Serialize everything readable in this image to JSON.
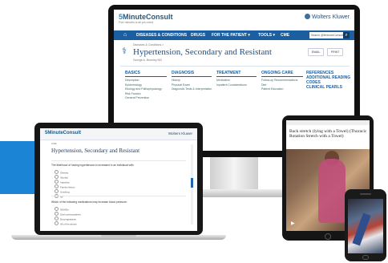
{
  "monitor": {
    "logo_prefix": "5",
    "logo_rest": "MinuteConsult",
    "tagline": "Five minutes is all you need",
    "brand": "Wolters Kluwer",
    "nav": [
      "DISEASES & CONDITIONS",
      "DRUGS",
      "FOR THE PATIENT ▾",
      "TOOLS ▾",
      "CME"
    ],
    "search_placeholder": "Search @5minuteConsult",
    "breadcrumb": "Diseases & Conditions >",
    "title": "Hypertension, Secondary and Resistant",
    "author": "George A. Bromley MD",
    "buttons": [
      "EMAIL",
      "PRINT"
    ],
    "columns": [
      {
        "heading": "BASICS",
        "items": [
          "Description",
          "Epidemiology",
          "Etiology and Pathophysiology",
          "Risk Factors",
          "General Prevention"
        ]
      },
      {
        "heading": "DIAGNOSIS",
        "items": [
          "History",
          "Physical Exam",
          "Diagnostic Tests & Interpretation"
        ]
      },
      {
        "heading": "TREATMENT",
        "items": [
          "Medication",
          "Inpatient Considerations"
        ]
      },
      {
        "heading": "ONGOING CARE",
        "items": [
          "Follow-up Recommendations",
          "Diet",
          "Patient Education"
        ]
      }
    ],
    "references": [
      "REFERENCES",
      "ADDITIONAL READING",
      "CODES",
      "CLINICAL PEARLS"
    ]
  },
  "laptop": {
    "logo": "5MinuteConsult",
    "brand": "Wolters Kluwer",
    "breadcrumb": "CME",
    "title": "Hypertension, Secondary and Resistant",
    "author": "",
    "questions": [
      {
        "text": "The likelihood of having hypertension is increased in an individual with:",
        "options": [
          "Obesity",
          "Alcohol",
          "Inactivity",
          "Family history",
          "Smoking",
          "All"
        ]
      },
      {
        "text": "Which of the following medications may increase blood pressure:",
        "options": [
          "NSAIDs",
          "Oral contraceptives",
          "Decongestants",
          "All of the above"
        ]
      }
    ]
  },
  "tablet": {
    "caption": "Back stretch (lying with a Towel) (Thoracic Rotation Stretch with a Towel)"
  },
  "colors": {
    "accent": "#1b84d4",
    "nav": "#1c5fa0",
    "title": "#1b4f86"
  }
}
